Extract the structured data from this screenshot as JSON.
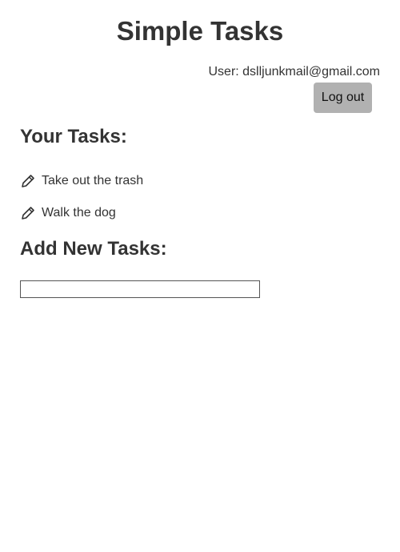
{
  "app": {
    "title": "Simple Tasks"
  },
  "header": {
    "user_text": "User: dslljunkmail@gmail.com",
    "logout_label": "Log out"
  },
  "tasks": {
    "heading": "Your Tasks:",
    "items": [
      {
        "label": "Take out the trash",
        "icon": "pencil-icon"
      },
      {
        "label": "Walk the dog",
        "icon": "pencil-icon"
      }
    ]
  },
  "add_task": {
    "heading": "Add New Tasks:",
    "input_value": "",
    "placeholder": ""
  },
  "colors": {
    "text": "#333333",
    "logout_button_bg": "#b1b1b1",
    "input_border": "#555555"
  }
}
